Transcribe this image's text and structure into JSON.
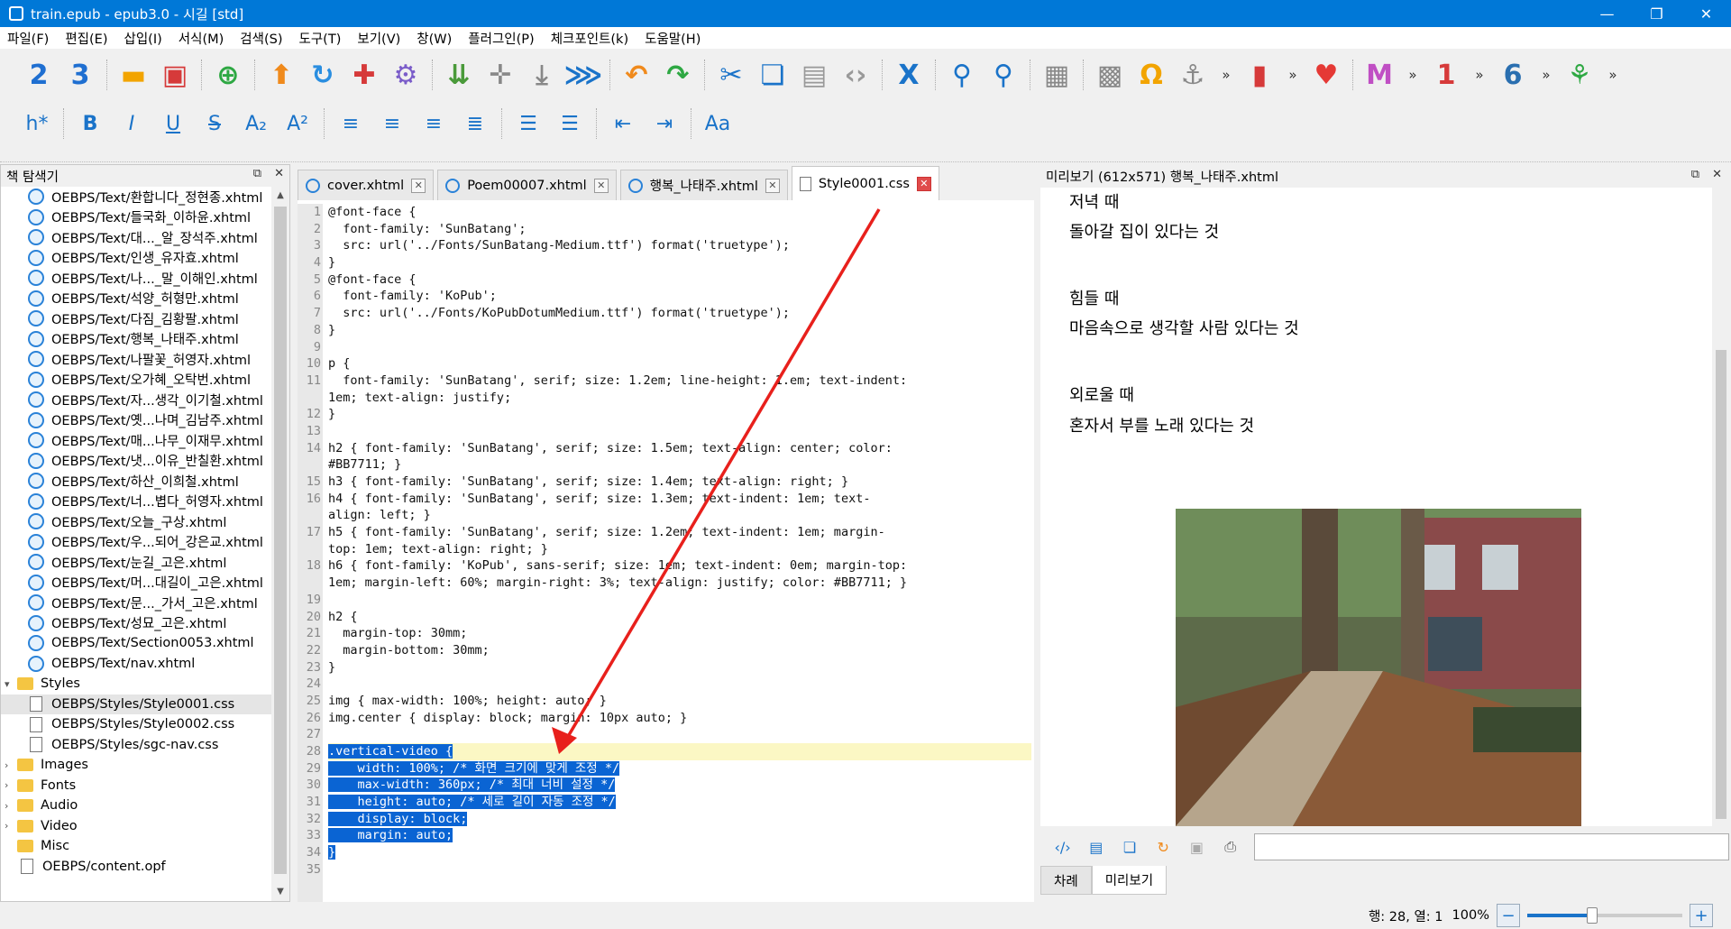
{
  "window": {
    "title": "train.epub - epub3.0 - 시길 [std]",
    "minimize": "—",
    "maximize": "❐",
    "close": "✕"
  },
  "menu": [
    "파일(F)",
    "편집(E)",
    "삽입(I)",
    "서식(M)",
    "검색(S)",
    "도구(T)",
    "보기(V)",
    "창(W)",
    "플러그인(P)",
    "체크포인트(k)",
    "도움말(H)"
  ],
  "toolbar1": {
    "items": [
      {
        "name": "book-2-icon",
        "glyph": "2",
        "color": "#1f6fd1"
      },
      {
        "name": "book-3-icon",
        "glyph": "3",
        "color": "#1f6fd1"
      },
      {
        "name": "sep"
      },
      {
        "name": "open-folder-icon",
        "glyph": "▬",
        "color": "#f2a400"
      },
      {
        "name": "save-icon",
        "glyph": "▣",
        "color": "#d63a3a"
      },
      {
        "name": "sep"
      },
      {
        "name": "add-file-icon",
        "glyph": "⊕",
        "color": "#2ea843"
      },
      {
        "name": "sep"
      },
      {
        "name": "up-arrow-icon",
        "glyph": "⬆",
        "color": "#f08a1c"
      },
      {
        "name": "refresh-icon",
        "glyph": "↻",
        "color": "#2a8ee0"
      },
      {
        "name": "add-top-icon",
        "glyph": "✚",
        "color": "#d63a3a"
      },
      {
        "name": "gear-icon",
        "glyph": "⚙",
        "color": "#7a5cc9"
      },
      {
        "name": "sep"
      },
      {
        "name": "insert-line-icon",
        "glyph": "⇊",
        "color": "#4a9a3a"
      },
      {
        "name": "insert-plus-icon",
        "glyph": "✛",
        "color": "#888"
      },
      {
        "name": "insert-down-icon",
        "glyph": "⤓",
        "color": "#888"
      },
      {
        "name": "move-down-icon",
        "glyph": "⋙",
        "color": "#1a73c9"
      },
      {
        "name": "sep"
      },
      {
        "name": "undo-icon",
        "glyph": "↶",
        "color": "#f08a1c"
      },
      {
        "name": "redo-icon",
        "glyph": "↷",
        "color": "#2ea843"
      },
      {
        "name": "sep"
      },
      {
        "name": "cut-icon",
        "glyph": "✂",
        "color": "#1a73c9"
      },
      {
        "name": "copy-icon",
        "glyph": "❏",
        "color": "#1a73c9"
      },
      {
        "name": "paste-icon",
        "glyph": "▤",
        "color": "#999"
      },
      {
        "name": "code-icon",
        "glyph": "‹›",
        "color": "#999"
      },
      {
        "name": "sep"
      },
      {
        "name": "x-check-icon",
        "glyph": "X",
        "color": "#1a73c9"
      },
      {
        "name": "sep"
      },
      {
        "name": "search-icon",
        "glyph": "⚲",
        "color": "#1a73c9"
      },
      {
        "name": "search-replace-icon",
        "glyph": "⚲",
        "color": "#1a73c9"
      },
      {
        "name": "sep"
      },
      {
        "name": "split-icon",
        "glyph": "▦",
        "color": "#888"
      },
      {
        "name": "sep"
      },
      {
        "name": "image-icon",
        "glyph": "▩",
        "color": "#888"
      },
      {
        "name": "omega-icon",
        "glyph": "Ω",
        "color": "#f2a400"
      },
      {
        "name": "anchor-icon",
        "glyph": "⚓",
        "color": "#888"
      },
      {
        "name": "more-icon",
        "glyph": "»",
        "color": "#333",
        "small": true
      },
      {
        "name": "bookmark-icon",
        "glyph": "▮",
        "color": "#d63a3a"
      },
      {
        "name": "more-icon",
        "glyph": "»",
        "color": "#333",
        "small": true
      },
      {
        "name": "heart-icon",
        "glyph": "♥",
        "color": "#e53935"
      },
      {
        "name": "sep"
      },
      {
        "name": "m-icon",
        "glyph": "M",
        "color": "#c04fc4"
      },
      {
        "name": "more-icon",
        "glyph": "»",
        "color": "#333",
        "small": true
      },
      {
        "name": "puzzle-1-icon",
        "glyph": "1",
        "color": "#d63a3a"
      },
      {
        "name": "more-icon",
        "glyph": "»",
        "color": "#333",
        "small": true
      },
      {
        "name": "puzzle-6-icon",
        "glyph": "6",
        "color": "#2a6fb0"
      },
      {
        "name": "more-icon",
        "glyph": "»",
        "color": "#333",
        "small": true
      },
      {
        "name": "tree-icon",
        "glyph": "⚘",
        "color": "#2ea843"
      },
      {
        "name": "more-icon",
        "glyph": "»",
        "color": "#333",
        "small": true
      }
    ]
  },
  "toolbar2": {
    "items": [
      {
        "name": "heading-icon",
        "glyph": "h*"
      },
      {
        "name": "sep"
      },
      {
        "name": "bold-icon",
        "glyph": "B"
      },
      {
        "name": "italic-icon",
        "glyph": "I"
      },
      {
        "name": "underline-icon",
        "glyph": "U"
      },
      {
        "name": "strikethrough-icon",
        "glyph": "S"
      },
      {
        "name": "subscript-icon",
        "glyph": "A₂"
      },
      {
        "name": "superscript-icon",
        "glyph": "A²"
      },
      {
        "name": "sep"
      },
      {
        "name": "align-left-icon",
        "glyph": "≡"
      },
      {
        "name": "align-center-icon",
        "glyph": "≡"
      },
      {
        "name": "align-right-icon",
        "glyph": "≡"
      },
      {
        "name": "align-justify-icon",
        "glyph": "≣"
      },
      {
        "name": "sep"
      },
      {
        "name": "bullet-list-icon",
        "glyph": "☰"
      },
      {
        "name": "number-list-icon",
        "glyph": "☰"
      },
      {
        "name": "sep"
      },
      {
        "name": "outdent-icon",
        "glyph": "⇤"
      },
      {
        "name": "indent-icon",
        "glyph": "⇥"
      },
      {
        "name": "sep"
      },
      {
        "name": "case-icon",
        "glyph": "Aa"
      }
    ]
  },
  "bookbrowser": {
    "title": "책 탐색기",
    "items": [
      {
        "type": "xhtml",
        "label": "OEBPS/Text/환합니다_정현종.xhtml"
      },
      {
        "type": "xhtml",
        "label": "OEBPS/Text/들국화_이하윤.xhtml"
      },
      {
        "type": "xhtml",
        "label": "OEBPS/Text/대..._알_장석주.xhtml"
      },
      {
        "type": "xhtml",
        "label": "OEBPS/Text/인생_유자효.xhtml"
      },
      {
        "type": "xhtml",
        "label": "OEBPS/Text/나..._말_이해인.xhtml"
      },
      {
        "type": "xhtml",
        "label": "OEBPS/Text/석양_허형만.xhtml"
      },
      {
        "type": "xhtml",
        "label": "OEBPS/Text/다짐_김황팔.xhtml"
      },
      {
        "type": "xhtml",
        "label": "OEBPS/Text/행복_나태주.xhtml"
      },
      {
        "type": "xhtml",
        "label": "OEBPS/Text/나팔꽃_허영자.xhtml"
      },
      {
        "type": "xhtml",
        "label": "OEBPS/Text/오가혜_오탁번.xhtml"
      },
      {
        "type": "xhtml",
        "label": "OEBPS/Text/자...생각_이기철.xhtml"
      },
      {
        "type": "xhtml",
        "label": "OEBPS/Text/옛...나며_김남주.xhtml"
      },
      {
        "type": "xhtml",
        "label": "OEBPS/Text/매...나무_이재무.xhtml"
      },
      {
        "type": "xhtml",
        "label": "OEBPS/Text/냇...이유_반칠환.xhtml"
      },
      {
        "type": "xhtml",
        "label": "OEBPS/Text/하산_이희철.xhtml"
      },
      {
        "type": "xhtml",
        "label": "OEBPS/Text/너...볍다_허영자.xhtml"
      },
      {
        "type": "xhtml",
        "label": "OEBPS/Text/오늘_구상.xhtml"
      },
      {
        "type": "xhtml",
        "label": "OEBPS/Text/우...되어_강은교.xhtml"
      },
      {
        "type": "xhtml",
        "label": "OEBPS/Text/눈길_고은.xhtml"
      },
      {
        "type": "xhtml",
        "label": "OEBPS/Text/머...대길이_고은.xhtml"
      },
      {
        "type": "xhtml",
        "label": "OEBPS/Text/문..._가서_고은.xhtml"
      },
      {
        "type": "xhtml",
        "label": "OEBPS/Text/성묘_고은.xhtml"
      },
      {
        "type": "xhtml",
        "label": "OEBPS/Text/Section0053.xhtml"
      },
      {
        "type": "xhtml",
        "label": "OEBPS/Text/nav.xhtml"
      },
      {
        "type": "folder-open",
        "label": "Styles"
      },
      {
        "type": "css",
        "label": "OEBPS/Styles/Style0001.css",
        "selected": true
      },
      {
        "type": "css",
        "label": "OEBPS/Styles/Style0002.css"
      },
      {
        "type": "css",
        "label": "OEBPS/Styles/sgc-nav.css"
      },
      {
        "type": "folder",
        "label": "Images"
      },
      {
        "type": "folder",
        "label": "Fonts"
      },
      {
        "type": "folder",
        "label": "Audio"
      },
      {
        "type": "folder",
        "label": "Video"
      },
      {
        "type": "folder-leaf",
        "label": "Misc"
      },
      {
        "type": "file",
        "label": "OEBPS/content.opf"
      }
    ]
  },
  "tabs": [
    {
      "label": "cover.xhtml",
      "active": false
    },
    {
      "label": "Poem00007.xhtml",
      "active": false
    },
    {
      "label": "행복_나태주.xhtml",
      "active": false
    },
    {
      "label": "Style0001.css",
      "active": true
    }
  ],
  "code": {
    "gutter": [
      "1",
      "2",
      "3",
      "4",
      "5",
      "6",
      "7",
      "8",
      "9",
      "10",
      "11",
      "",
      "12",
      "13",
      "14",
      "",
      "15",
      "16",
      "",
      "17",
      "",
      "18",
      "",
      "19",
      "20",
      "21",
      "22",
      "23",
      "24",
      "25",
      "26",
      "27",
      "28",
      "29",
      "30",
      "31",
      "32",
      "33",
      "34",
      "35"
    ],
    "lines": [
      {
        "t": "@font-face {"
      },
      {
        "t": "  font-family: 'SunBatang';"
      },
      {
        "t": "  src: url('../Fonts/SunBatang-Medium.ttf') format('truetype');"
      },
      {
        "t": "}"
      },
      {
        "t": "@font-face {"
      },
      {
        "t": "  font-family: 'KoPub';"
      },
      {
        "t": "  src: url('../Fonts/KoPubDotumMedium.ttf') format('truetype');"
      },
      {
        "t": "}"
      },
      {
        "t": ""
      },
      {
        "t": "p {"
      },
      {
        "t": "  font-family: 'SunBatang', serif; size: 1.2em; line-height: 1.em; text-indent:"
      },
      {
        "t": "1em; text-align: justify;"
      },
      {
        "t": "}"
      },
      {
        "t": ""
      },
      {
        "t": "h2 { font-family: 'SunBatang', serif; size: 1.5em; text-align: center; color:"
      },
      {
        "t": "#BB7711; }"
      },
      {
        "t": "h3 { font-family: 'SunBatang', serif; size: 1.4em; text-align: right; }"
      },
      {
        "t": "h4 { font-family: 'SunBatang', serif; size: 1.3em; text-indent: 1em; text-"
      },
      {
        "t": "align: left; }"
      },
      {
        "t": "h5 { font-family: 'SunBatang', serif; size: 1.2em; text-indent: 1em; margin-"
      },
      {
        "t": "top: 1em; text-align: right; }"
      },
      {
        "t": "h6 { font-family: 'KoPub', sans-serif; size: 1em; text-indent: 0em; margin-top:"
      },
      {
        "t": "1em; margin-left: 60%; margin-right: 3%; text-align: justify; color: #BB7711; }"
      },
      {
        "t": ""
      },
      {
        "t": "h2 {"
      },
      {
        "t": "  margin-top: 30mm;"
      },
      {
        "t": "  margin-bottom: 30mm;"
      },
      {
        "t": "}"
      },
      {
        "t": ""
      },
      {
        "t": "img { max-width: 100%; height: auto; }"
      },
      {
        "t": "img.center { display: block; margin: 10px auto; }"
      },
      {
        "t": ""
      },
      {
        "t": ".vertical-video {",
        "sel": true,
        "cur": true
      },
      {
        "t": "    width: 100%; /* 화면 크기에 맞게 조정 */",
        "sel": true
      },
      {
        "t": "    max-width: 360px; /* 최대 너비 설정 */",
        "sel": true
      },
      {
        "t": "    height: auto; /* 세로 길이 자동 조정 */",
        "sel": true
      },
      {
        "t": "    display: block;",
        "sel": true
      },
      {
        "t": "    margin: auto;",
        "sel": true
      },
      {
        "t": "}",
        "sel": true
      },
      {
        "t": ""
      }
    ]
  },
  "preview": {
    "title": "미리보기 (612x571) 행복_나태주.xhtml",
    "lines": [
      {
        "text": "저녁 때"
      },
      {
        "text": "돌아갈 집이 있다는 것"
      },
      {
        "text": "힘들 때"
      },
      {
        "text": "마음속으로 생각할 사람 있다는 것"
      },
      {
        "text": "외로울 때"
      },
      {
        "text": "혼자서 부를 노래 있다는 것"
      }
    ],
    "bottom_icons": [
      "code-view-icon",
      "list-view-icon",
      "copy-view-icon",
      "reload-icon",
      "disabled-icon",
      "print-icon"
    ],
    "tabs": [
      {
        "label": "차례",
        "active": false
      },
      {
        "label": "미리보기",
        "active": true
      }
    ]
  },
  "status": {
    "position": "행: 28, 열: 1",
    "zoom": "100%",
    "zoom_level": 0.42,
    "zoom_out": "−",
    "zoom_in": "+"
  },
  "annotation": {
    "color": "#e8201c"
  }
}
